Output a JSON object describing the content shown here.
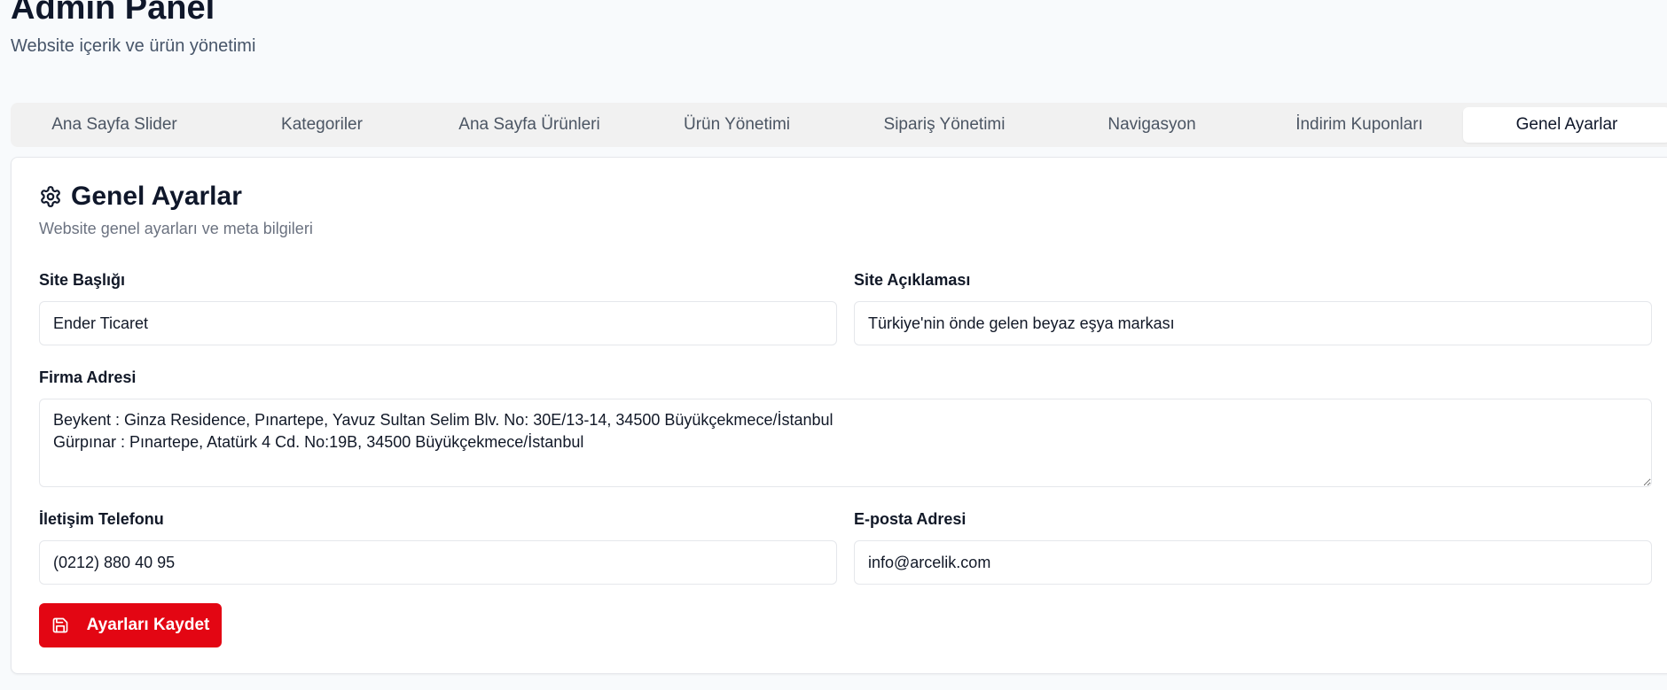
{
  "header": {
    "title": "Admin Panel",
    "subtitle": "Website içerik ve ürün yönetimi"
  },
  "tabs": [
    {
      "label": "Ana Sayfa Slider"
    },
    {
      "label": "Kategoriler"
    },
    {
      "label": "Ana Sayfa Ürünleri"
    },
    {
      "label": "Ürün Yönetimi"
    },
    {
      "label": "Sipariş Yönetimi"
    },
    {
      "label": "Navigasyon"
    },
    {
      "label": "İndirim Kuponları"
    },
    {
      "label": "Genel Ayarlar",
      "active": true
    }
  ],
  "card": {
    "icon": "gear-icon",
    "title": "Genel Ayarlar",
    "description": "Website genel ayarları ve meta bilgileri"
  },
  "form": {
    "site_title": {
      "label": "Site Başlığı",
      "value": "Ender Ticaret"
    },
    "site_description": {
      "label": "Site Açıklaması",
      "value": "Türkiye'nin önde gelen beyaz eşya markası"
    },
    "company_address": {
      "label": "Firma Adresi",
      "value": "Beykent : Ginza Residence, Pınartepe, Yavuz Sultan Selim Blv. No: 30E/13-14, 34500 Büyükçekmece/İstanbul\nGürpınar : Pınartepe, Atatürk 4 Cd. No:19B, 34500 Büyükçekmece/İstanbul"
    },
    "phone": {
      "label": "İletişim Telefonu",
      "value": "(0212) 880 40 95"
    },
    "email": {
      "label": "E-posta Adresi",
      "value": "info@arcelik.com"
    }
  },
  "actions": {
    "save_label": "Ayarları Kaydet",
    "save_icon": "save-icon"
  },
  "colors": {
    "accent": "#e30613",
    "tab_bar": "#f1f1f1",
    "background": "#f8fafc"
  }
}
